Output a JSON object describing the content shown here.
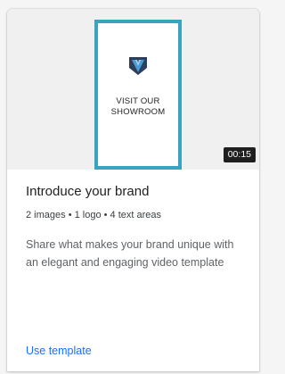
{
  "card": {
    "preview": {
      "thumbnail_text": "VISIT OUR\nSHOWROOM",
      "logo_icon": "v-shield-logo-icon",
      "duration": "00:15",
      "accent_color": "#3aa3bd"
    },
    "title": "Introduce your brand",
    "meta": "2 images • 1 logo • 4 text areas",
    "description": "Share what makes your brand unique with an elegant and engaging video template",
    "action_label": "Use template",
    "link_color": "#1a73e8"
  }
}
